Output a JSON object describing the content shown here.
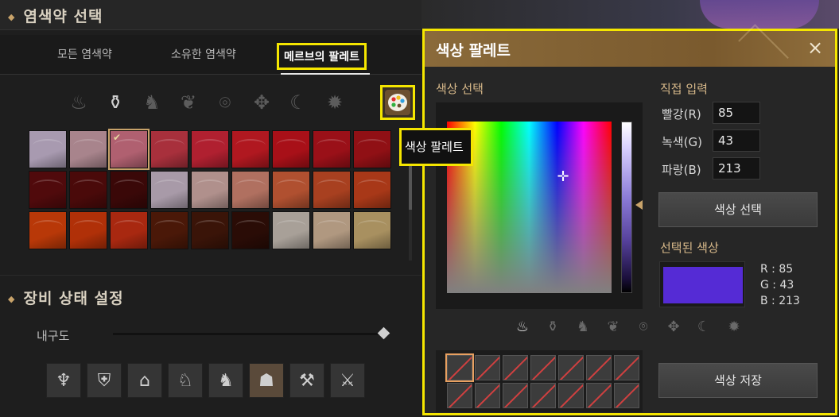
{
  "dye_select": {
    "title": "염색약 선택",
    "tabs": [
      {
        "label": "모든 염색약"
      },
      {
        "label": "소유한 염색약"
      },
      {
        "label": "메르브의 팔레트"
      }
    ],
    "category_icons": [
      "dye-pot-icon",
      "potion-icon",
      "horse-icon",
      "dragon-icon",
      "compass-icon",
      "eagle-icon",
      "moon-icon",
      "gear-target-icon"
    ],
    "palette_tooltip": "색상 팔레트",
    "swatches": [
      [
        "#a89ab0",
        "#a8848c",
        "#b06070",
        "#a8303c",
        "#b02030",
        "#b01820",
        "#a81018",
        "#9a1018",
        "#901015"
      ],
      [
        "#500a0c",
        "#4a0a0a",
        "#3a0808",
        "#a89aa8",
        "#b0908c",
        "#b07060",
        "#b05030",
        "#a84020",
        "#a83818"
      ],
      [
        "#b83808",
        "#b03008",
        "#a82810",
        "#4a1808",
        "#3a1408",
        "#2a0c06",
        "#a8a098",
        "#b09880",
        "#a89060"
      ]
    ]
  },
  "equip": {
    "title": "장비 상태 설정",
    "durability_label": "내구도",
    "durability_value": 1.0,
    "items": [
      "armor-icon",
      "cloak-icon",
      "helmet-icon",
      "horse-armor-icon",
      "horse-saddle-icon",
      "hood-icon",
      "weapon-pile-icon",
      "sword-icon"
    ]
  },
  "palette_dialog": {
    "title": "색상 팔레트",
    "close": "×",
    "color_select_label": "색상 선택",
    "direct_input_label": "직접 입력",
    "red_label": "빨강(R)",
    "green_label": "녹색(G)",
    "blue_label": "파랑(B)",
    "red_value": "85",
    "green_value": "43",
    "blue_value": "213",
    "select_button": "색상 선택",
    "selected_label": "선택된 색상",
    "selected_color": "#552bd5",
    "r_readout": "R : 85",
    "g_readout": "G : 43",
    "b_readout": "B : 213",
    "save_button": "색상 저장",
    "slot_count": 14
  }
}
